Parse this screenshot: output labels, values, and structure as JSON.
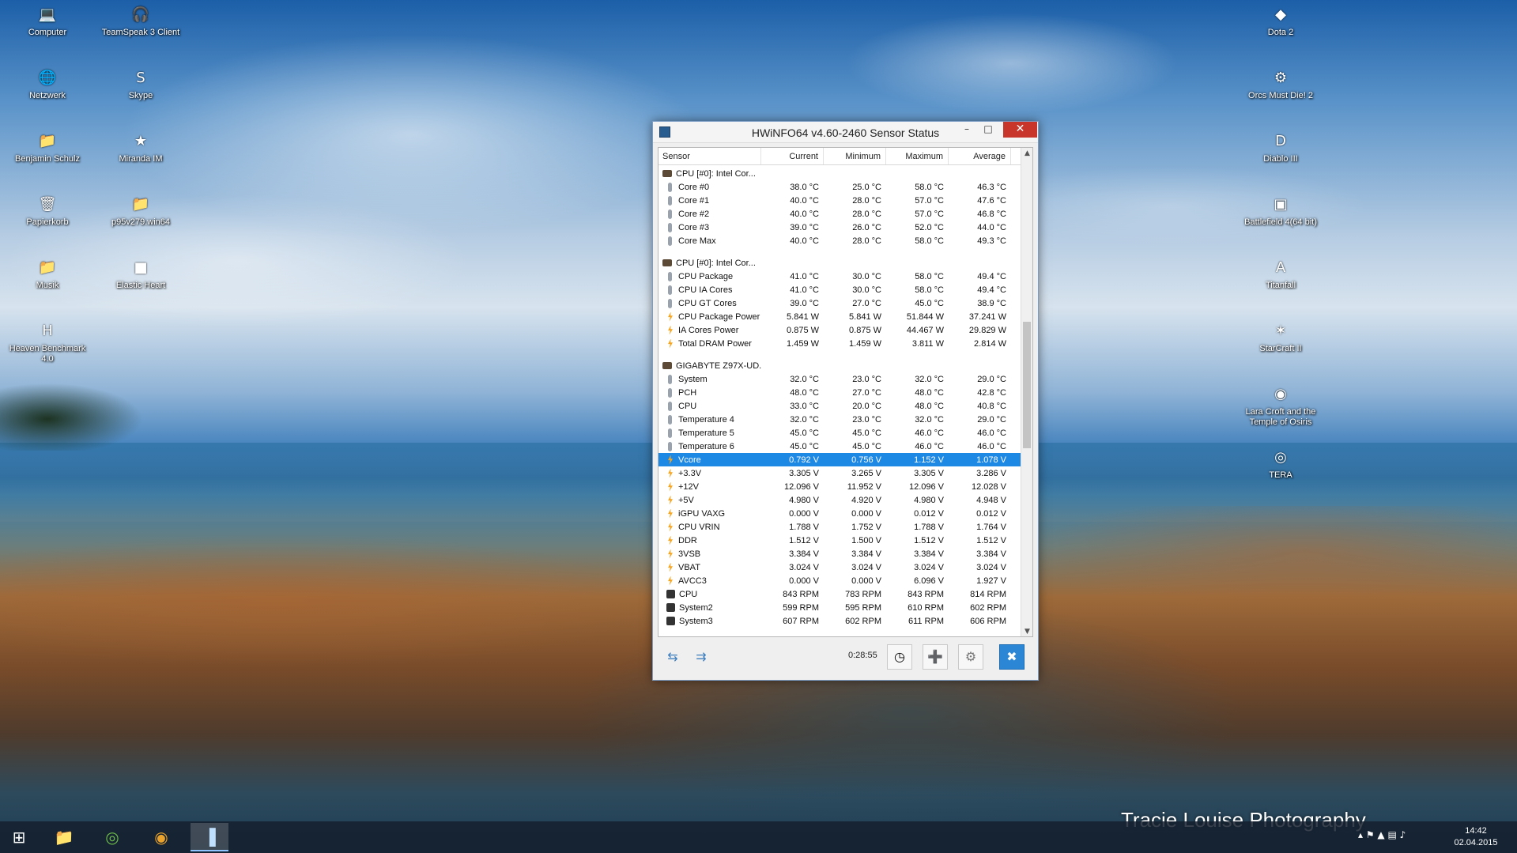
{
  "desktop": {
    "left_icons": [
      {
        "label": "Computer",
        "icon": "computer-icon",
        "glyph": "💻"
      },
      {
        "label": "TeamSpeak 3 Client",
        "icon": "teamspeak-icon",
        "glyph": "🎧"
      },
      {
        "label": "Netzwerk",
        "icon": "network-icon",
        "glyph": "🌐"
      },
      {
        "label": "Skype",
        "icon": "skype-icon",
        "glyph": "S"
      },
      {
        "label": "Benjamin Schulz",
        "icon": "user-folder-icon",
        "glyph": "📁"
      },
      {
        "label": "Miranda IM",
        "icon": "miranda-icon",
        "glyph": "★"
      },
      {
        "label": "Papierkorb",
        "icon": "recycle-bin-icon",
        "glyph": "🗑"
      },
      {
        "label": "p95v279.win64",
        "icon": "folder-icon",
        "glyph": "📁"
      },
      {
        "label": "Musik",
        "icon": "music-folder-icon",
        "glyph": "📁"
      },
      {
        "label": "Elastic Heart",
        "icon": "media-file-icon",
        "glyph": "■"
      },
      {
        "label": "Heaven Benchmark 4.0",
        "icon": "benchmark-icon",
        "glyph": "H"
      }
    ],
    "right_icons": [
      {
        "label": "Dota 2",
        "icon": "dota2-icon",
        "glyph": "◆"
      },
      {
        "label": "Orcs Must Die! 2",
        "icon": "orcs-must-die-icon",
        "glyph": "⚙"
      },
      {
        "label": "Diablo III",
        "icon": "diablo-icon",
        "glyph": "D"
      },
      {
        "label": "Battlefield 4(64 bit)",
        "icon": "battlefield-icon",
        "glyph": "▣"
      },
      {
        "label": "Titanfall",
        "icon": "titanfall-icon",
        "glyph": "A"
      },
      {
        "label": "StarCraft II",
        "icon": "starcraft-icon",
        "glyph": "✶"
      },
      {
        "label": "Lara Croft and the Temple of Osiris",
        "icon": "lara-croft-icon",
        "glyph": "◉"
      },
      {
        "label": "TERA",
        "icon": "tera-icon",
        "glyph": "◎"
      }
    ]
  },
  "window": {
    "title": "HWiNFO64 v4.60-2460 Sensor Status",
    "minimize": "–",
    "maximize": "□",
    "close": "✕",
    "columns": [
      "Sensor",
      "Current",
      "Minimum",
      "Maximum",
      "Average"
    ],
    "rows": [
      {
        "type": "group",
        "icon": "chip",
        "name": "CPU [#0]: Intel Cor...",
        "cur": "",
        "min": "",
        "max": "",
        "avg": ""
      },
      {
        "type": "sub",
        "icon": "temp",
        "name": "Core #0",
        "cur": "38.0 °C",
        "min": "25.0 °C",
        "max": "58.0 °C",
        "avg": "46.3 °C"
      },
      {
        "type": "sub",
        "icon": "temp",
        "name": "Core #1",
        "cur": "40.0 °C",
        "min": "28.0 °C",
        "max": "57.0 °C",
        "avg": "47.6 °C"
      },
      {
        "type": "sub",
        "icon": "temp",
        "name": "Core #2",
        "cur": "40.0 °C",
        "min": "28.0 °C",
        "max": "57.0 °C",
        "avg": "46.8 °C"
      },
      {
        "type": "sub",
        "icon": "temp",
        "name": "Core #3",
        "cur": "39.0 °C",
        "min": "26.0 °C",
        "max": "52.0 °C",
        "avg": "44.0 °C"
      },
      {
        "type": "sub",
        "icon": "temp",
        "name": "Core Max",
        "cur": "40.0 °C",
        "min": "28.0 °C",
        "max": "58.0 °C",
        "avg": "49.3 °C"
      },
      {
        "type": "spacer"
      },
      {
        "type": "group",
        "icon": "chip",
        "name": "CPU [#0]: Intel Cor...",
        "cur": "",
        "min": "",
        "max": "",
        "avg": ""
      },
      {
        "type": "sub",
        "icon": "temp",
        "name": "CPU Package",
        "cur": "41.0 °C",
        "min": "30.0 °C",
        "max": "58.0 °C",
        "avg": "49.4 °C"
      },
      {
        "type": "sub",
        "icon": "temp",
        "name": "CPU IA Cores",
        "cur": "41.0 °C",
        "min": "30.0 °C",
        "max": "58.0 °C",
        "avg": "49.4 °C"
      },
      {
        "type": "sub",
        "icon": "temp",
        "name": "CPU GT Cores",
        "cur": "39.0 °C",
        "min": "27.0 °C",
        "max": "45.0 °C",
        "avg": "38.9 °C"
      },
      {
        "type": "sub",
        "icon": "volt",
        "name": "CPU Package Power",
        "cur": "5.841 W",
        "min": "5.841 W",
        "max": "51.844 W",
        "avg": "37.241 W"
      },
      {
        "type": "sub",
        "icon": "volt",
        "name": "IA Cores Power",
        "cur": "0.875 W",
        "min": "0.875 W",
        "max": "44.467 W",
        "avg": "29.829 W"
      },
      {
        "type": "sub",
        "icon": "volt",
        "name": "Total DRAM Power",
        "cur": "1.459 W",
        "min": "1.459 W",
        "max": "3.811 W",
        "avg": "2.814 W"
      },
      {
        "type": "spacer"
      },
      {
        "type": "group",
        "icon": "chip",
        "name": "GIGABYTE Z97X-UD...",
        "cur": "",
        "min": "",
        "max": "",
        "avg": ""
      },
      {
        "type": "sub",
        "icon": "temp",
        "name": "System",
        "cur": "32.0 °C",
        "min": "23.0 °C",
        "max": "32.0 °C",
        "avg": "29.0 °C"
      },
      {
        "type": "sub",
        "icon": "temp",
        "name": "PCH",
        "cur": "48.0 °C",
        "min": "27.0 °C",
        "max": "48.0 °C",
        "avg": "42.8 °C"
      },
      {
        "type": "sub",
        "icon": "temp",
        "name": "CPU",
        "cur": "33.0 °C",
        "min": "20.0 °C",
        "max": "48.0 °C",
        "avg": "40.8 °C"
      },
      {
        "type": "sub",
        "icon": "temp",
        "name": "Temperature 4",
        "cur": "32.0 °C",
        "min": "23.0 °C",
        "max": "32.0 °C",
        "avg": "29.0 °C"
      },
      {
        "type": "sub",
        "icon": "temp",
        "name": "Temperature 5",
        "cur": "45.0 °C",
        "min": "45.0 °C",
        "max": "46.0 °C",
        "avg": "46.0 °C"
      },
      {
        "type": "sub",
        "icon": "temp",
        "name": "Temperature 6",
        "cur": "45.0 °C",
        "min": "45.0 °C",
        "max": "46.0 °C",
        "avg": "46.0 °C"
      },
      {
        "type": "sub",
        "icon": "volt",
        "name": "Vcore",
        "cur": "0.792 V",
        "min": "0.756 V",
        "max": "1.152 V",
        "avg": "1.078 V",
        "selected": true
      },
      {
        "type": "sub",
        "icon": "volt",
        "name": "+3.3V",
        "cur": "3.305 V",
        "min": "3.265 V",
        "max": "3.305 V",
        "avg": "3.286 V"
      },
      {
        "type": "sub",
        "icon": "volt",
        "name": "+12V",
        "cur": "12.096 V",
        "min": "11.952 V",
        "max": "12.096 V",
        "avg": "12.028 V"
      },
      {
        "type": "sub",
        "icon": "volt",
        "name": "+5V",
        "cur": "4.980 V",
        "min": "4.920 V",
        "max": "4.980 V",
        "avg": "4.948 V"
      },
      {
        "type": "sub",
        "icon": "volt",
        "name": "iGPU VAXG",
        "cur": "0.000 V",
        "min": "0.000 V",
        "max": "0.012 V",
        "avg": "0.012 V"
      },
      {
        "type": "sub",
        "icon": "volt",
        "name": "CPU VRIN",
        "cur": "1.788 V",
        "min": "1.752 V",
        "max": "1.788 V",
        "avg": "1.764 V"
      },
      {
        "type": "sub",
        "icon": "volt",
        "name": "DDR",
        "cur": "1.512 V",
        "min": "1.500 V",
        "max": "1.512 V",
        "avg": "1.512 V"
      },
      {
        "type": "sub",
        "icon": "volt",
        "name": "3VSB",
        "cur": "3.384 V",
        "min": "3.384 V",
        "max": "3.384 V",
        "avg": "3.384 V"
      },
      {
        "type": "sub",
        "icon": "volt",
        "name": "VBAT",
        "cur": "3.024 V",
        "min": "3.024 V",
        "max": "3.024 V",
        "avg": "3.024 V"
      },
      {
        "type": "sub",
        "icon": "volt",
        "name": "AVCC3",
        "cur": "0.000 V",
        "min": "0.000 V",
        "max": "6.096 V",
        "avg": "1.927 V"
      },
      {
        "type": "sub",
        "icon": "fan",
        "name": "CPU",
        "cur": "843 RPM",
        "min": "783 RPM",
        "max": "843 RPM",
        "avg": "814 RPM"
      },
      {
        "type": "sub",
        "icon": "fan",
        "name": "System2",
        "cur": "599 RPM",
        "min": "595 RPM",
        "max": "610 RPM",
        "avg": "602 RPM"
      },
      {
        "type": "sub",
        "icon": "fan",
        "name": "System3",
        "cur": "607 RPM",
        "min": "602 RPM",
        "max": "611 RPM",
        "avg": "606 RPM"
      }
    ],
    "toolbar": {
      "timer": "0:28:55",
      "nav_expand": "⇆",
      "nav_collapse": "⇉",
      "clock_glyph": "◷",
      "report_glyph": "➕",
      "settings_glyph": "⚙",
      "close_glyph": "✖"
    }
  },
  "taskbar": {
    "start_glyph": "⊞",
    "explorer_glyph": "📁",
    "app2_glyph": "◎",
    "chrome_glyph": "◉",
    "hwinfo_glyph": "▐",
    "clock_time": "14:42",
    "clock_date": "02.04.2015",
    "tray_glyphs": "▴  ⚑  ▲  ▤  ♪"
  },
  "watermark": "Tracie Louise Photography"
}
